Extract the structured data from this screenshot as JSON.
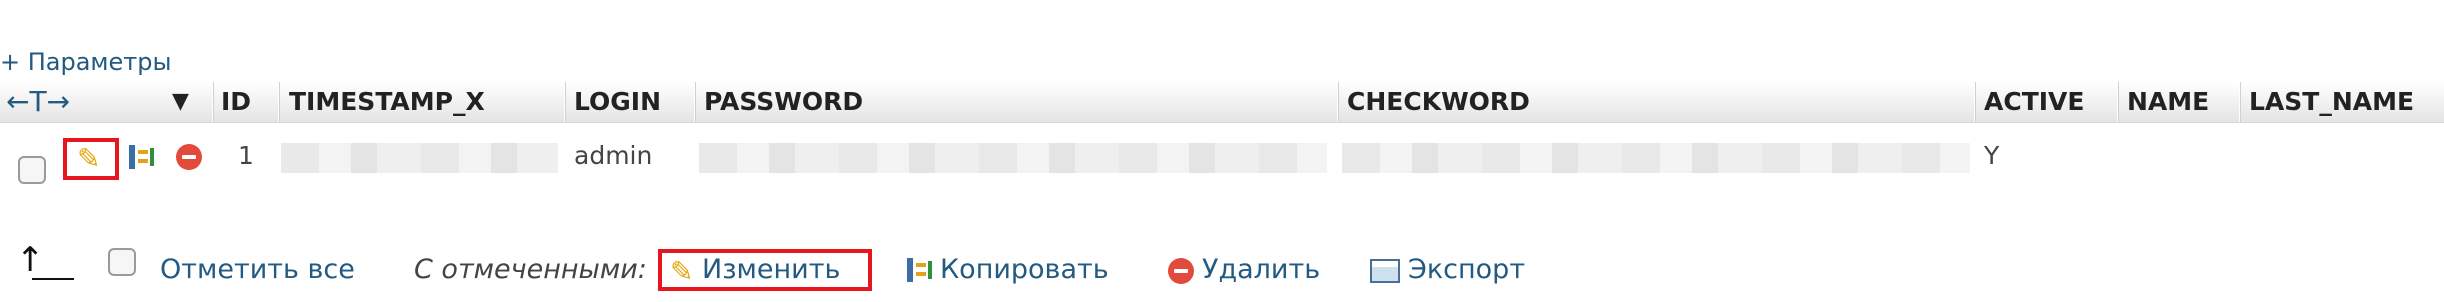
{
  "options_link": "+ Параметры",
  "header": {
    "resize_glyph": "←T→",
    "sort_glyph": "▼",
    "columns": [
      "ID",
      "TIMESTAMP_X",
      "LOGIN",
      "PASSWORD",
      "CHECKWORD",
      "ACTIVE",
      "NAME",
      "LAST_NAME"
    ]
  },
  "row": {
    "id": "1",
    "login": "admin",
    "active": "Y"
  },
  "footer": {
    "check_all": "Отметить все",
    "with_selected": "С отмеченными:",
    "edit": "Изменить",
    "copy": "Копировать",
    "delete": "Удалить",
    "export": "Экспорт"
  },
  "icons": {
    "edit": "pencil-icon",
    "copy": "copy-icon",
    "delete": "delete-icon",
    "export": "export-icon"
  },
  "colors": {
    "link": "#235a81",
    "highlight": "#e5161d",
    "delete": "#e24a3b"
  }
}
